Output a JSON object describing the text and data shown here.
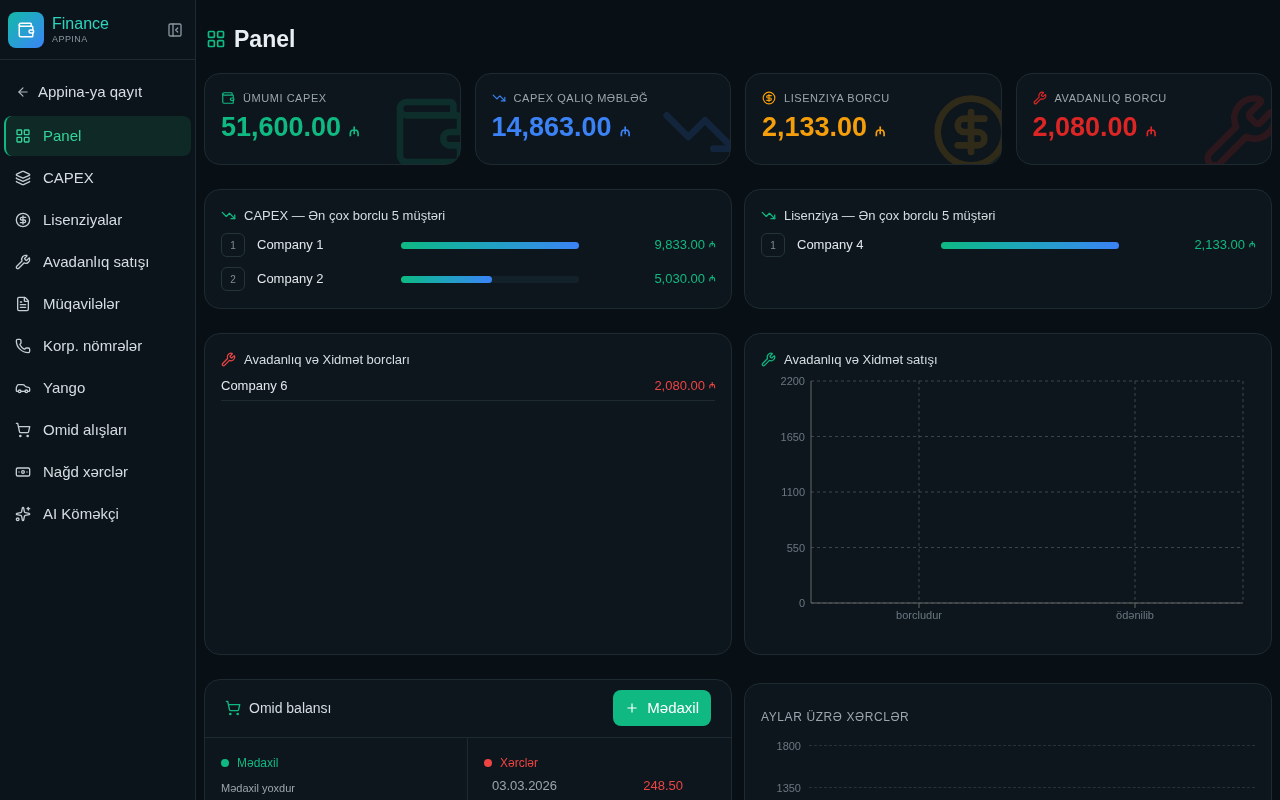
{
  "sidebar": {
    "brand": {
      "title": "Finance",
      "subtitle": "APPINA"
    },
    "back": "Appina-ya qayıt",
    "items": [
      {
        "label": "Panel",
        "selected": true
      },
      {
        "label": "CAPEX",
        "selected": false
      },
      {
        "label": "Lisenziyalar",
        "selected": false
      },
      {
        "label": "Avadanlıq satışı",
        "selected": false
      },
      {
        "label": "Müqavilələr",
        "selected": false
      },
      {
        "label": "Korp. nömrələr",
        "selected": false
      },
      {
        "label": "Yango",
        "selected": false
      },
      {
        "label": "Omid alışları",
        "selected": false
      },
      {
        "label": "Nağd xərclər",
        "selected": false
      },
      {
        "label": "AI Köməkçi",
        "selected": false
      }
    ]
  },
  "page_title": "Panel",
  "stats": [
    {
      "label": "ÜMUMI CAPEX",
      "value": "51,600.00",
      "currency": "₼",
      "color": "#10b981"
    },
    {
      "label": "CAPEX QALIQ MƏBLƏĞ",
      "value": "14,863.00",
      "currency": "₼",
      "color": "#3b82f6"
    },
    {
      "label": "LISENZIYA BORCU",
      "value": "2,133.00",
      "currency": "₼",
      "color": "#f59e0b"
    },
    {
      "label": "AVADANLIQ BORCU",
      "value": "2,080.00",
      "currency": "₼",
      "color": "#dc2626"
    }
  ],
  "top_debtors": [
    {
      "title": "CAPEX — Ən çox borclu 5 müştəri",
      "rows": [
        {
          "rank": "1",
          "name": "Company 1",
          "level": 1.0,
          "amount": "9,833.00",
          "currency": "₼"
        },
        {
          "rank": "2",
          "name": "Company 2",
          "level": 0.51,
          "amount": "5,030.00",
          "currency": "₼"
        }
      ]
    },
    {
      "title": "Lisenziya — Ən çox borclu 5 müştəri",
      "rows": [
        {
          "rank": "1",
          "name": "Company 4",
          "level": 1.0,
          "amount": "2,133.00",
          "currency": "₼"
        }
      ]
    }
  ],
  "equipment_debts": {
    "title": "Avadanlıq və Xidmət borcları",
    "rows": [
      {
        "name": "Company 6",
        "amount": "2,080.00",
        "currency": "₼"
      }
    ]
  },
  "equipment_sales": {
    "title": "Avadanlıq və Xidmət satışı",
    "chart_data": {
      "type": "bar",
      "categories": [
        "borcludur",
        "ödənilib"
      ],
      "values": [
        0,
        0
      ],
      "ylim": [
        0,
        2200
      ],
      "yticks": [
        0,
        550,
        1100,
        1650,
        2200
      ],
      "grid": true
    }
  },
  "omid_balance": {
    "title": "Omid balansı",
    "button": "Mədaxil",
    "income": {
      "title": "Mədaxil",
      "empty": "Mədaxil yoxdur"
    },
    "expenses": {
      "title": "Xərclər",
      "rows": [
        {
          "date": "03.03.2026",
          "amount": "248.50"
        }
      ]
    }
  },
  "monthly_expenses": {
    "title": "AYLAR ÜZRƏ XƏRCLƏR",
    "y_axis_labels": [
      "1800",
      "1350"
    ]
  }
}
